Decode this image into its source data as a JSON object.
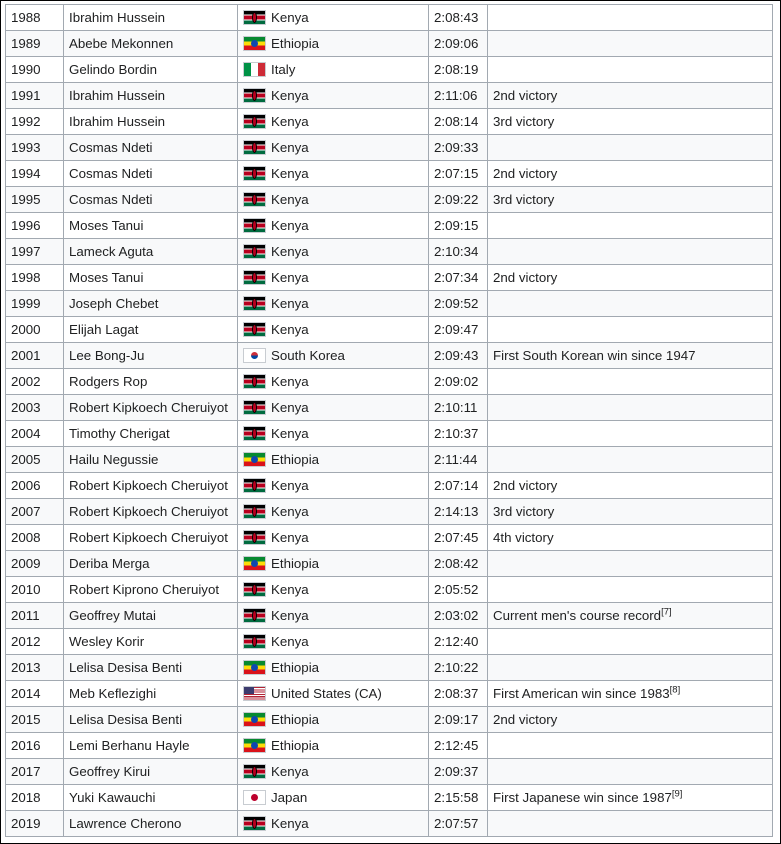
{
  "rows": [
    {
      "year": "1988",
      "year_link": false,
      "athlete": "Ibrahim Hussein",
      "athlete_link": true,
      "country": "Kenya",
      "country_link": true,
      "flag": "flag-kenya",
      "time": "2:08:43",
      "note": "",
      "ref": ""
    },
    {
      "year": "1989",
      "year_link": false,
      "athlete": "Abebe Mekonnen",
      "athlete_link": true,
      "country": "Ethiopia",
      "country_link": true,
      "flag": "flag-ethiopia",
      "time": "2:09:06",
      "note": "",
      "ref": ""
    },
    {
      "year": "1990",
      "year_link": false,
      "athlete": "Gelindo Bordin",
      "athlete_link": true,
      "country": "Italy",
      "country_link": true,
      "flag": "flag-italy",
      "time": "2:08:19",
      "note": "",
      "ref": ""
    },
    {
      "year": "1991",
      "year_link": false,
      "athlete": "Ibrahim Hussein",
      "athlete_link": false,
      "country": "Kenya",
      "country_link": false,
      "flag": "flag-kenya",
      "time": "2:11:06",
      "note": "2nd victory",
      "ref": ""
    },
    {
      "year": "1992",
      "year_link": false,
      "athlete": "Ibrahim Hussein",
      "athlete_link": false,
      "country": "Kenya",
      "country_link": false,
      "flag": "flag-kenya",
      "time": "2:08:14",
      "note": "3rd victory",
      "ref": ""
    },
    {
      "year": "1993",
      "year_link": false,
      "athlete": "Cosmas Ndeti",
      "athlete_link": true,
      "country": "Kenya",
      "country_link": false,
      "flag": "flag-kenya",
      "time": "2:09:33",
      "note": "",
      "ref": ""
    },
    {
      "year": "1994",
      "year_link": false,
      "athlete": "Cosmas Ndeti",
      "athlete_link": false,
      "country": "Kenya",
      "country_link": false,
      "flag": "flag-kenya",
      "time": "2:07:15",
      "note": "2nd victory",
      "ref": ""
    },
    {
      "year": "1995",
      "year_link": false,
      "athlete": "Cosmas Ndeti",
      "athlete_link": false,
      "country": "Kenya",
      "country_link": false,
      "flag": "flag-kenya",
      "time": "2:09:22",
      "note": "3rd victory",
      "ref": ""
    },
    {
      "year": "1996",
      "year_link": false,
      "athlete": "Moses Tanui",
      "athlete_link": true,
      "country": "Kenya",
      "country_link": false,
      "flag": "flag-kenya",
      "time": "2:09:15",
      "note": "",
      "ref": ""
    },
    {
      "year": "1997",
      "year_link": false,
      "athlete": "Lameck Aguta",
      "athlete_link": true,
      "country": "Kenya",
      "country_link": false,
      "flag": "flag-kenya",
      "time": "2:10:34",
      "note": "",
      "ref": ""
    },
    {
      "year": "1998",
      "year_link": false,
      "athlete": "Moses Tanui",
      "athlete_link": false,
      "country": "Kenya",
      "country_link": false,
      "flag": "flag-kenya",
      "time": "2:07:34",
      "note": "2nd victory",
      "ref": ""
    },
    {
      "year": "1999",
      "year_link": false,
      "athlete": "Joseph Chebet",
      "athlete_link": true,
      "country": "Kenya",
      "country_link": false,
      "flag": "flag-kenya",
      "time": "2:09:52",
      "note": "",
      "ref": ""
    },
    {
      "year": "2000",
      "year_link": false,
      "athlete": "Elijah Lagat",
      "athlete_link": true,
      "country": "Kenya",
      "country_link": false,
      "flag": "flag-kenya",
      "time": "2:09:47",
      "note": "",
      "ref": ""
    },
    {
      "year": "2001",
      "year_link": false,
      "athlete": "Lee Bong-Ju",
      "athlete_link": true,
      "country": "South Korea",
      "country_link": false,
      "flag": "flag-korea",
      "time": "2:09:43",
      "note": "First South Korean win since 1947",
      "ref": ""
    },
    {
      "year": "2002",
      "year_link": false,
      "athlete": "Rodgers Rop",
      "athlete_link": true,
      "country": "Kenya",
      "country_link": false,
      "flag": "flag-kenya",
      "time": "2:09:02",
      "note": "",
      "ref": ""
    },
    {
      "year": "2003",
      "year_link": false,
      "athlete": "Robert Kipkoech Cheruiyot",
      "athlete_link": true,
      "country": "Kenya",
      "country_link": false,
      "flag": "flag-kenya",
      "time": "2:10:11",
      "note": "",
      "ref": ""
    },
    {
      "year": "2004",
      "year_link": false,
      "athlete": "Timothy Cherigat",
      "athlete_link": true,
      "country": "Kenya",
      "country_link": false,
      "flag": "flag-kenya",
      "time": "2:10:37",
      "note": "",
      "ref": ""
    },
    {
      "year": "2005",
      "year_link": false,
      "athlete": "Hailu Negussie",
      "athlete_link": true,
      "country": "Ethiopia",
      "country_link": false,
      "flag": "flag-ethiopia",
      "time": "2:11:44",
      "note": "",
      "ref": ""
    },
    {
      "year": "2006",
      "year_link": false,
      "athlete": "Robert Kipkoech Cheruiyot",
      "athlete_link": false,
      "country": "Kenya",
      "country_link": false,
      "flag": "flag-kenya",
      "time": "2:07:14",
      "note": "2nd victory",
      "ref": ""
    },
    {
      "year": "2007",
      "year_link": false,
      "athlete": "Robert Kipkoech Cheruiyot",
      "athlete_link": false,
      "country": "Kenya",
      "country_link": false,
      "flag": "flag-kenya",
      "time": "2:14:13",
      "note": "3rd victory",
      "ref": ""
    },
    {
      "year": "2008",
      "year_link": false,
      "athlete": "Robert Kipkoech Cheruiyot",
      "athlete_link": false,
      "country": "Kenya",
      "country_link": false,
      "flag": "flag-kenya",
      "time": "2:07:45",
      "note": "4th victory",
      "ref": ""
    },
    {
      "year": "2009",
      "year_link": false,
      "athlete": "Deriba Merga",
      "athlete_link": true,
      "country": "Ethiopia",
      "country_link": false,
      "flag": "flag-ethiopia",
      "time": "2:08:42",
      "note": "",
      "ref": ""
    },
    {
      "year": "2010",
      "year_link": false,
      "athlete": "Robert Kiprono Cheruiyot",
      "athlete_link": true,
      "country": "Kenya",
      "country_link": false,
      "flag": "flag-kenya",
      "time": "2:05:52",
      "note": "",
      "ref": ""
    },
    {
      "year": "2011",
      "year_link": true,
      "athlete": "Geoffrey Mutai",
      "athlete_link": true,
      "country": "Kenya",
      "country_link": false,
      "flag": "flag-kenya",
      "time": "2:03:02",
      "note": "Current men's course record",
      "ref": "[7]"
    },
    {
      "year": "2012",
      "year_link": true,
      "athlete": "Wesley Korir",
      "athlete_link": true,
      "country": "Kenya",
      "country_link": false,
      "flag": "flag-kenya",
      "time": "2:12:40",
      "note": "",
      "ref": ""
    },
    {
      "year": "2013",
      "year_link": true,
      "athlete": "Lelisa Desisa Benti",
      "athlete_link": true,
      "country": "Ethiopia",
      "country_link": false,
      "flag": "flag-ethiopia",
      "time": "2:10:22",
      "note": "",
      "ref": ""
    },
    {
      "year": "2014",
      "year_link": true,
      "athlete": "Meb Keflezighi",
      "athlete_link": true,
      "country": "United States (CA)",
      "country_link": true,
      "flag": "flag-usa",
      "time": "2:08:37",
      "note": "First American win since 1983",
      "ref": "[8]"
    },
    {
      "year": "2015",
      "year_link": true,
      "athlete": "Lelisa Desisa Benti",
      "athlete_link": false,
      "country": "Ethiopia",
      "country_link": false,
      "flag": "flag-ethiopia",
      "time": "2:09:17",
      "note": "2nd victory",
      "ref": ""
    },
    {
      "year": "2016",
      "year_link": true,
      "athlete": "Lemi Berhanu Hayle",
      "athlete_link": true,
      "country": "Ethiopia",
      "country_link": true,
      "flag": "flag-ethiopia",
      "time": "2:12:45",
      "note": "",
      "ref": ""
    },
    {
      "year": "2017",
      "year_link": true,
      "athlete": "Geoffrey Kirui",
      "athlete_link": true,
      "country": "Kenya",
      "country_link": false,
      "flag": "flag-kenya",
      "time": "2:09:37",
      "note": "",
      "ref": ""
    },
    {
      "year": "2018",
      "year_link": true,
      "athlete": "Yuki Kawauchi",
      "athlete_link": true,
      "country": "Japan",
      "country_link": false,
      "flag": "flag-japan",
      "time": "2:15:58",
      "note": "First Japanese win since 1987",
      "ref": "[9]"
    },
    {
      "year": "2019",
      "year_link": true,
      "athlete": "Lawrence Cherono",
      "athlete_link": true,
      "country": "Kenya",
      "country_link": false,
      "flag": "flag-kenya",
      "time": "2:07:57",
      "note": "",
      "ref": ""
    }
  ],
  "colors": {
    "link": "#3366cc",
    "text": "#202122",
    "border": "#a2a9b1",
    "stripe": "#f8f9fa"
  },
  "flag_icons": {
    "flag-kenya": "kenya-flag-icon",
    "flag-ethiopia": "ethiopia-flag-icon",
    "flag-italy": "italy-flag-icon",
    "flag-korea": "south-korea-flag-icon",
    "flag-usa": "united-states-flag-icon",
    "flag-japan": "japan-flag-icon"
  }
}
